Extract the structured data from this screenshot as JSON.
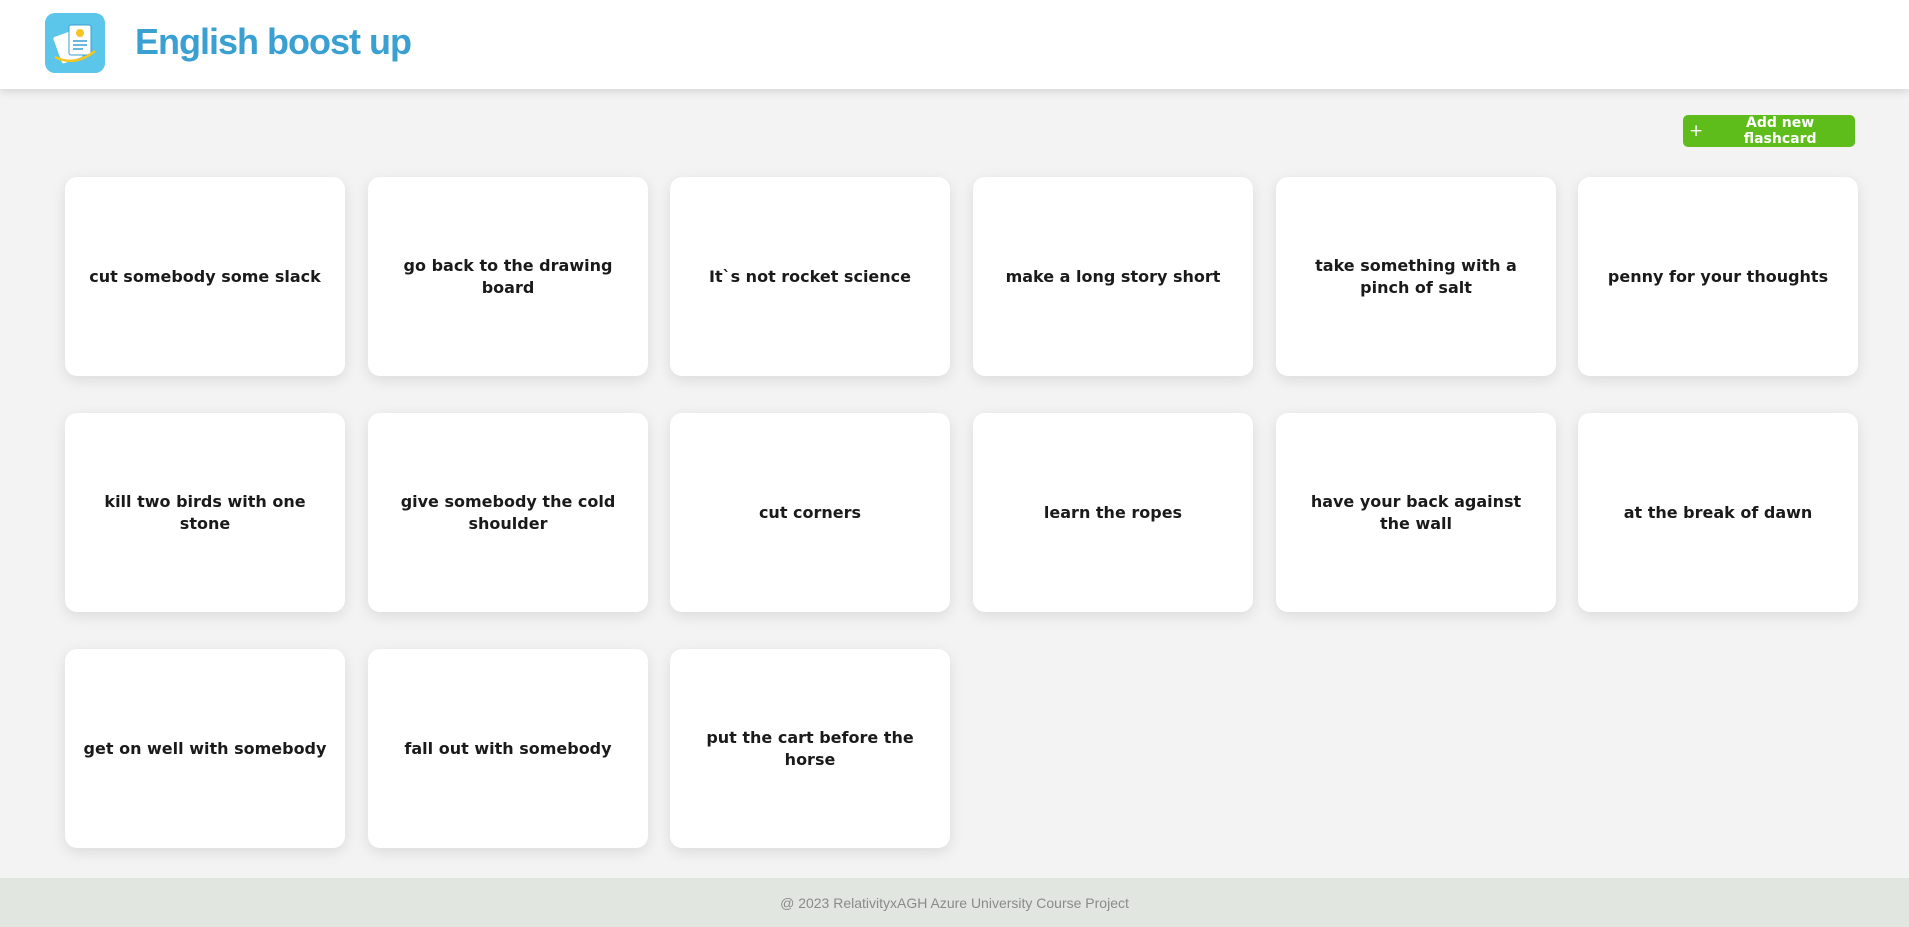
{
  "header": {
    "title": "English boost up",
    "logo_icon": "flashcards-logo-icon"
  },
  "toolbar": {
    "add_label": "Add new flashcard",
    "add_icon": "plus-icon",
    "add_color": "#5fbd1b"
  },
  "cards": [
    "cut somebody some slack",
    "go back to the drawing board",
    "It`s not rocket science",
    "make a long story short",
    "take something with a pinch of salt",
    "penny for your thoughts",
    "kill two birds with one stone",
    "give somebody the cold shoulder",
    "cut corners",
    "learn the ropes",
    "have your back against the wall",
    "at the break of dawn",
    "get on well with somebody",
    "fall out with somebody",
    "put the cart before the horse"
  ],
  "footer": {
    "text": "@ 2023 RelativityxAGH Azure University Course Project"
  },
  "colors": {
    "accent": "#3a9fd1",
    "logo_bg": "#5bc6ea",
    "page_bg": "#f3f3f3",
    "footer_bg": "#e2e6e1"
  }
}
